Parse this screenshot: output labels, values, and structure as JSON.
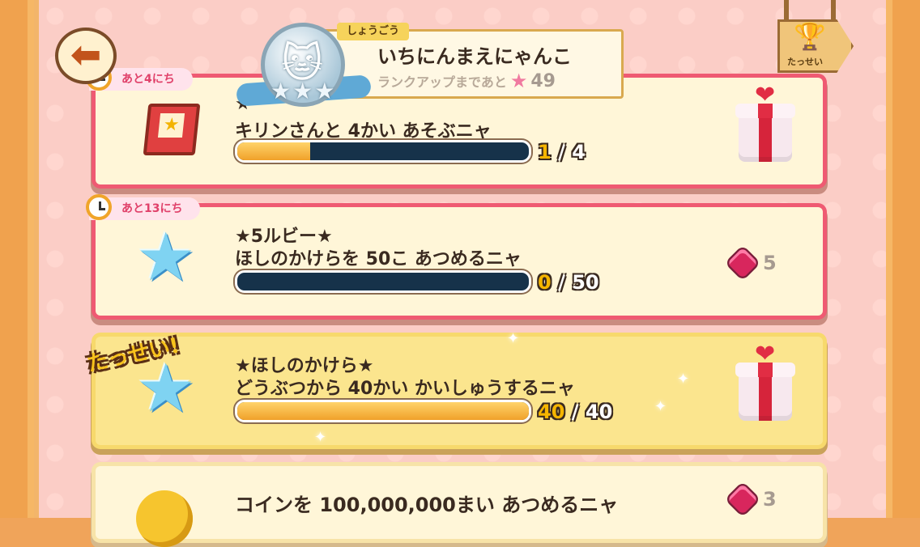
{
  "header": {
    "rank_tag": "しょうごう",
    "rank_title": "いちにんまえにゃんこ",
    "rank_up_text": "ランクアップまであと",
    "rank_up_count": "49",
    "achievements_label": "たっせい"
  },
  "missions": [
    {
      "days_left": "あと4にち",
      "name": "★",
      "description": "キリンさんと 4かい あそぶニャ",
      "progress_current": "1",
      "progress_separator": "/",
      "progress_total": "4",
      "progress_fraction": 0.25,
      "reward": "gift-icon"
    },
    {
      "days_left": "あと13にち",
      "name": "★5ルビー★",
      "description": "ほしのかけらを 50こ あつめるニャ",
      "progress_current": "0",
      "progress_separator": "/",
      "progress_total": "50",
      "progress_fraction": 0,
      "reward_ruby_count": "5"
    },
    {
      "achieved_label": "たっせい!",
      "name": "★ほしのかけら★",
      "description": "どうぶつから 40かい かいしゅうするニャ",
      "progress_current": "40",
      "progress_separator": "/",
      "progress_total": "40",
      "progress_fraction": 1.0,
      "reward": "gift-icon"
    },
    {
      "description": "コインを 100,000,000まい あつめるニャ",
      "reward_ruby_count": "3"
    }
  ],
  "colors": {
    "card_border_active": "#ef5a72",
    "card_done_bg": "#fbe58e",
    "progress_fill": "#f0a12a",
    "progress_empty": "#16324a"
  }
}
